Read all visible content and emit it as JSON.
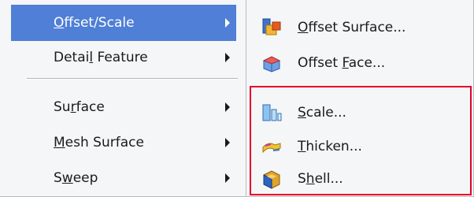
{
  "main_menu": {
    "items": [
      {
        "pre": "",
        "u": "O",
        "post": "ffset/Scale",
        "has_submenu": true,
        "highlighted": true
      },
      {
        "pre": "Detai",
        "u": "l",
        "post": " Feature",
        "has_submenu": true,
        "highlighted": false
      },
      {
        "pre": "Su",
        "u": "r",
        "post": "face",
        "has_submenu": true,
        "highlighted": false
      },
      {
        "pre": "",
        "u": "M",
        "post": "esh Surface",
        "has_submenu": true,
        "highlighted": false
      },
      {
        "pre": "S",
        "u": "w",
        "post": "eep",
        "has_submenu": true,
        "highlighted": false
      }
    ]
  },
  "submenu": {
    "items": [
      {
        "pre": "",
        "u": "O",
        "post": "ffset Surface...",
        "icon": "offset-surface-icon"
      },
      {
        "pre": "Offset ",
        "u": "F",
        "post": "ace...",
        "icon": "offset-face-icon"
      },
      {
        "pre": "",
        "u": "S",
        "post": "cale...",
        "icon": "scale-icon"
      },
      {
        "pre": "",
        "u": "T",
        "post": "hicken...",
        "icon": "thicken-icon"
      },
      {
        "pre": "S",
        "u": "h",
        "post": "ell...",
        "icon": "shell-icon"
      }
    ]
  },
  "colors": {
    "highlight": "#4f7fd6",
    "menu_bg": "#f5f6f7",
    "annotation_frame": "#e4002b"
  }
}
